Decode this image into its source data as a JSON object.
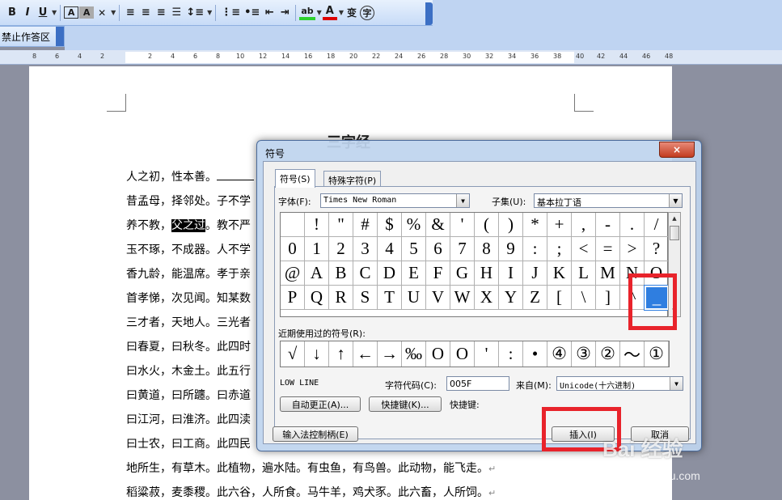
{
  "toolbar": {
    "bold": "B",
    "italic": "I",
    "underline": "U",
    "char_border": "A",
    "char_shading": "A",
    "ruby_icon": "文",
    "font_color": "A",
    "phonetic": "变",
    "enclosed": "字",
    "mode_label": "禁止作答区"
  },
  "ruler": {
    "ticks": [
      "8",
      "6",
      "4",
      "2",
      "2",
      "4",
      "6",
      "8",
      "10",
      "12",
      "14",
      "16",
      "18",
      "20",
      "22",
      "24",
      "26",
      "28",
      "30",
      "32",
      "34",
      "36",
      "38",
      "40",
      "42",
      "44",
      "46",
      "48"
    ]
  },
  "document": {
    "title": "三字经",
    "lines": [
      {
        "pre": "人之初，性本善。",
        "mid": "",
        "post": ""
      },
      {
        "pre": "昔孟母，择邻处。子不学",
        "mid": "",
        "post": ""
      },
      {
        "pre": "养不教，",
        "hl": "父之过",
        "post": "。教不严"
      },
      {
        "pre": "玉不琢，不成器。人不学",
        "mid": "",
        "post": ""
      },
      {
        "pre": "香九龄，能温席。孝于亲",
        "mid": "",
        "post": ""
      },
      {
        "pre": "首孝悌，次见闻。知某数",
        "mid": "",
        "post": ""
      },
      {
        "pre": "三才者，天地人。三光者",
        "mid": "",
        "post": ""
      },
      {
        "pre": "曰春夏，曰秋冬。此四时",
        "mid": "",
        "post": ""
      },
      {
        "pre": "曰水火，木金土。此五行",
        "mid": "",
        "post": ""
      },
      {
        "pre": "曰黄道，曰所躔。曰赤道",
        "mid": "",
        "post": ""
      },
      {
        "pre": "曰江河，曰淮济。此四渎",
        "mid": "",
        "post": ""
      },
      {
        "pre": "曰士农，曰工商。此四民",
        "mid": "",
        "post": ""
      },
      {
        "pre": "地所生，有草木。此植物，遍水陆。有虫鱼，有鸟兽。此动物，能飞走。",
        "mid": "",
        "post": "↵"
      },
      {
        "pre": "稻粱菽，麦黍稷。此六谷，人所食。马牛羊，鸡犬豕。此六畜，人所饲。",
        "mid": "",
        "post": "↵"
      }
    ]
  },
  "dialog": {
    "title": "符号",
    "close": "×",
    "tabs": [
      "符号(S)",
      "特殊字符(P)"
    ],
    "font_label": "字体(F):",
    "font_value": "Times New Roman",
    "subset_label": "子集(U):",
    "subset_value": "基本拉丁语",
    "symbols": [
      " ",
      "!",
      "\"",
      "#",
      "$",
      "%",
      "&",
      "'",
      "(",
      ")",
      "*",
      "+",
      ",",
      "-",
      ".",
      "/",
      "0",
      "1",
      "2",
      "3",
      "4",
      "5",
      "6",
      "7",
      "8",
      "9",
      ":",
      ";",
      "<",
      "=",
      ">",
      "?",
      "@",
      "A",
      "B",
      "C",
      "D",
      "E",
      "F",
      "G",
      "H",
      "I",
      "J",
      "K",
      "L",
      "M",
      "N",
      "O",
      "P",
      "Q",
      "R",
      "S",
      "T",
      "U",
      "V",
      "W",
      "X",
      "Y",
      "Z",
      "[",
      "\\",
      "]",
      "^",
      "_"
    ],
    "selected_index": 63,
    "recent_label": "近期使用过的符号(R):",
    "recent": [
      "√",
      "↓",
      "↑",
      "←",
      "→",
      "‰",
      "O",
      "O",
      "'",
      ":",
      "•",
      "④",
      "③",
      "②",
      "～",
      "①"
    ],
    "char_name": "LOW LINE",
    "code_label": "字符代码(C):",
    "code_value": "005F",
    "from_label": "来自(M):",
    "from_value": "Unicode(十六进制)",
    "autocorrect_button": "自动更正(A)...",
    "shortcut_button": "快捷键(K)...",
    "shortcut_label": "快捷键:",
    "ime_button": "输入法控制柄(E)",
    "insert_button": "插入(I)",
    "cancel_button": "取消"
  },
  "watermark": {
    "brand": "Bai 经验",
    "url": "jingyan.baidu.com"
  },
  "colors": {
    "highlight": "#e8232b",
    "selection": "#2f7ee0"
  }
}
